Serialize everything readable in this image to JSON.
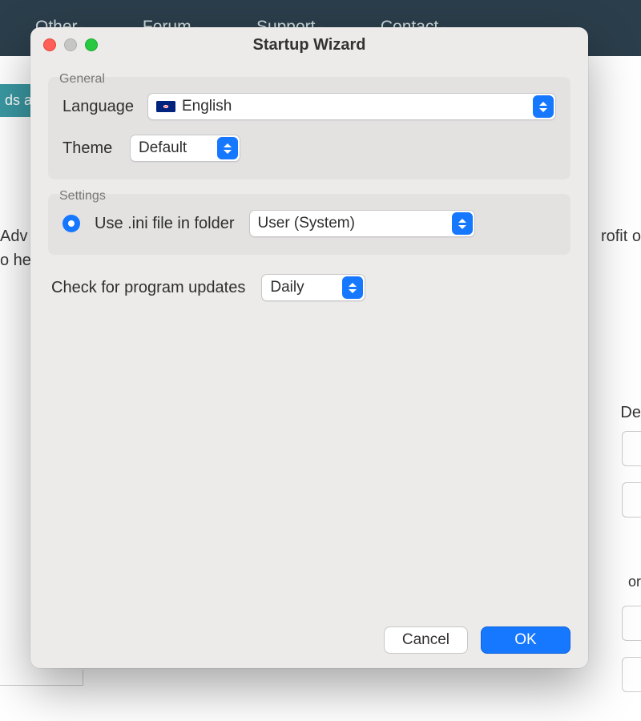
{
  "background": {
    "nav": [
      "Other",
      "Forum",
      "Support",
      "Contact"
    ],
    "pill": "ds a",
    "text1": "Adv",
    "text2": "o he",
    "text3": "rofit o",
    "right_label": "De",
    "or": "or"
  },
  "window": {
    "title": "Startup Wizard",
    "general": {
      "legend": "General",
      "language_label": "Language",
      "language_value": "English",
      "language_flag": "uk-flag-icon",
      "theme_label": "Theme",
      "theme_value": "Default"
    },
    "settings": {
      "legend": "Settings",
      "radio_label": "Use .ini file in folder",
      "folder_value": "User (System)"
    },
    "updates": {
      "label": "Check for program updates",
      "value": "Daily"
    },
    "buttons": {
      "cancel": "Cancel",
      "ok": "OK"
    }
  }
}
